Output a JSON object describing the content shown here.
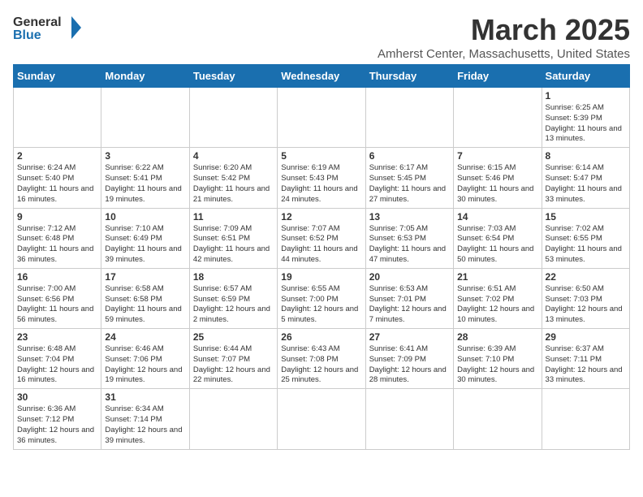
{
  "logo": {
    "line1": "General",
    "line2": "Blue"
  },
  "title": "March 2025",
  "location": "Amherst Center, Massachusetts, United States",
  "weekdays": [
    "Sunday",
    "Monday",
    "Tuesday",
    "Wednesday",
    "Thursday",
    "Friday",
    "Saturday"
  ],
  "weeks": [
    [
      null,
      null,
      null,
      null,
      null,
      null,
      {
        "day": "1",
        "info": "Sunrise: 6:25 AM\nSunset: 5:39 PM\nDaylight: 11 hours and 13 minutes."
      }
    ],
    [
      {
        "day": "2",
        "info": "Sunrise: 6:24 AM\nSunset: 5:40 PM\nDaylight: 11 hours and 16 minutes."
      },
      {
        "day": "3",
        "info": "Sunrise: 6:22 AM\nSunset: 5:41 PM\nDaylight: 11 hours and 19 minutes."
      },
      {
        "day": "4",
        "info": "Sunrise: 6:20 AM\nSunset: 5:42 PM\nDaylight: 11 hours and 21 minutes."
      },
      {
        "day": "5",
        "info": "Sunrise: 6:19 AM\nSunset: 5:43 PM\nDaylight: 11 hours and 24 minutes."
      },
      {
        "day": "6",
        "info": "Sunrise: 6:17 AM\nSunset: 5:45 PM\nDaylight: 11 hours and 27 minutes."
      },
      {
        "day": "7",
        "info": "Sunrise: 6:15 AM\nSunset: 5:46 PM\nDaylight: 11 hours and 30 minutes."
      },
      {
        "day": "8",
        "info": "Sunrise: 6:14 AM\nSunset: 5:47 PM\nDaylight: 11 hours and 33 minutes."
      }
    ],
    [
      {
        "day": "9",
        "info": "Sunrise: 7:12 AM\nSunset: 6:48 PM\nDaylight: 11 hours and 36 minutes."
      },
      {
        "day": "10",
        "info": "Sunrise: 7:10 AM\nSunset: 6:49 PM\nDaylight: 11 hours and 39 minutes."
      },
      {
        "day": "11",
        "info": "Sunrise: 7:09 AM\nSunset: 6:51 PM\nDaylight: 11 hours and 42 minutes."
      },
      {
        "day": "12",
        "info": "Sunrise: 7:07 AM\nSunset: 6:52 PM\nDaylight: 11 hours and 44 minutes."
      },
      {
        "day": "13",
        "info": "Sunrise: 7:05 AM\nSunset: 6:53 PM\nDaylight: 11 hours and 47 minutes."
      },
      {
        "day": "14",
        "info": "Sunrise: 7:03 AM\nSunset: 6:54 PM\nDaylight: 11 hours and 50 minutes."
      },
      {
        "day": "15",
        "info": "Sunrise: 7:02 AM\nSunset: 6:55 PM\nDaylight: 11 hours and 53 minutes."
      }
    ],
    [
      {
        "day": "16",
        "info": "Sunrise: 7:00 AM\nSunset: 6:56 PM\nDaylight: 11 hours and 56 minutes."
      },
      {
        "day": "17",
        "info": "Sunrise: 6:58 AM\nSunset: 6:58 PM\nDaylight: 11 hours and 59 minutes."
      },
      {
        "day": "18",
        "info": "Sunrise: 6:57 AM\nSunset: 6:59 PM\nDaylight: 12 hours and 2 minutes."
      },
      {
        "day": "19",
        "info": "Sunrise: 6:55 AM\nSunset: 7:00 PM\nDaylight: 12 hours and 5 minutes."
      },
      {
        "day": "20",
        "info": "Sunrise: 6:53 AM\nSunset: 7:01 PM\nDaylight: 12 hours and 7 minutes."
      },
      {
        "day": "21",
        "info": "Sunrise: 6:51 AM\nSunset: 7:02 PM\nDaylight: 12 hours and 10 minutes."
      },
      {
        "day": "22",
        "info": "Sunrise: 6:50 AM\nSunset: 7:03 PM\nDaylight: 12 hours and 13 minutes."
      }
    ],
    [
      {
        "day": "23",
        "info": "Sunrise: 6:48 AM\nSunset: 7:04 PM\nDaylight: 12 hours and 16 minutes."
      },
      {
        "day": "24",
        "info": "Sunrise: 6:46 AM\nSunset: 7:06 PM\nDaylight: 12 hours and 19 minutes."
      },
      {
        "day": "25",
        "info": "Sunrise: 6:44 AM\nSunset: 7:07 PM\nDaylight: 12 hours and 22 minutes."
      },
      {
        "day": "26",
        "info": "Sunrise: 6:43 AM\nSunset: 7:08 PM\nDaylight: 12 hours and 25 minutes."
      },
      {
        "day": "27",
        "info": "Sunrise: 6:41 AM\nSunset: 7:09 PM\nDaylight: 12 hours and 28 minutes."
      },
      {
        "day": "28",
        "info": "Sunrise: 6:39 AM\nSunset: 7:10 PM\nDaylight: 12 hours and 30 minutes."
      },
      {
        "day": "29",
        "info": "Sunrise: 6:37 AM\nSunset: 7:11 PM\nDaylight: 12 hours and 33 minutes."
      }
    ],
    [
      {
        "day": "30",
        "info": "Sunrise: 6:36 AM\nSunset: 7:12 PM\nDaylight: 12 hours and 36 minutes."
      },
      {
        "day": "31",
        "info": "Sunrise: 6:34 AM\nSunset: 7:14 PM\nDaylight: 12 hours and 39 minutes."
      },
      null,
      null,
      null,
      null,
      null
    ]
  ]
}
